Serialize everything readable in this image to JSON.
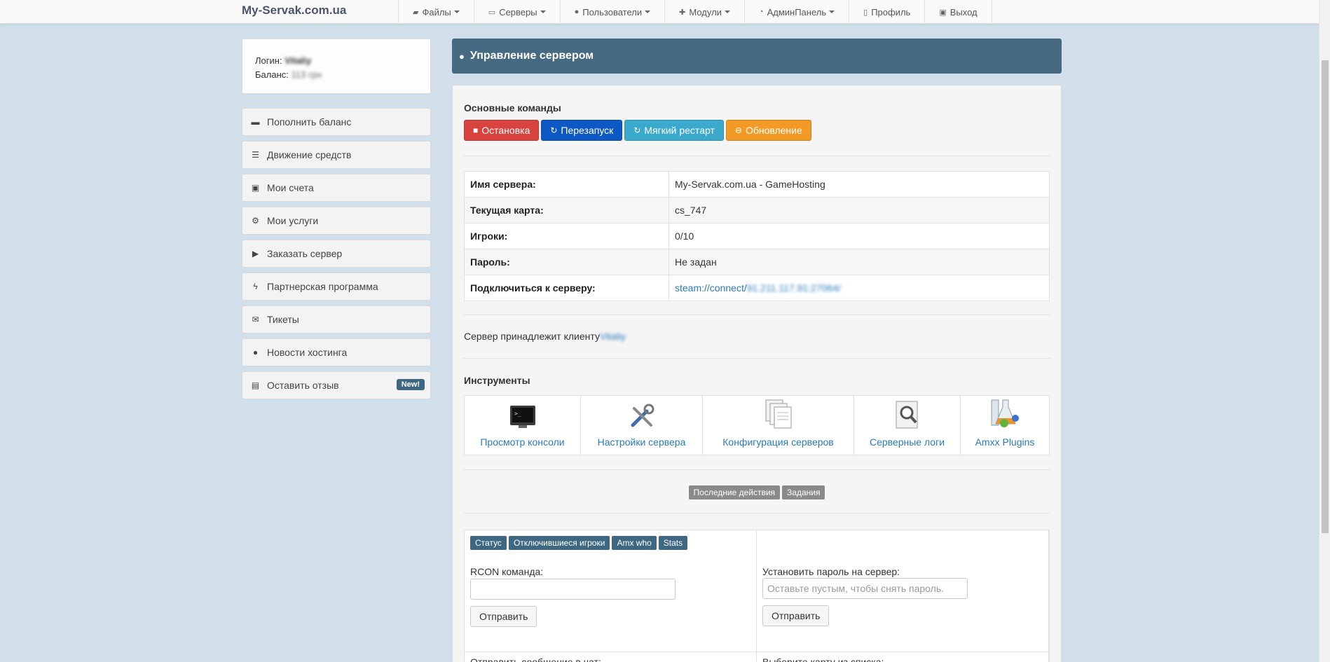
{
  "navbar": {
    "brand": "My-Servak.com.ua",
    "items": [
      {
        "label": "Файлы",
        "icon": "folder-open-icon",
        "glyph": "▰",
        "dropdown": true
      },
      {
        "label": "Серверы",
        "icon": "hdd-icon",
        "glyph": "▭",
        "dropdown": true
      },
      {
        "label": "Пользователи",
        "icon": "user-icon",
        "glyph": "●",
        "dropdown": true
      },
      {
        "label": "Модули",
        "icon": "plus-icon",
        "glyph": "✚",
        "dropdown": true
      },
      {
        "label": "АдминПанель",
        "icon": "rss-icon",
        "glyph": "◔",
        "dropdown": true
      },
      {
        "label": "Профиль",
        "icon": "file-icon",
        "glyph": "▯",
        "dropdown": false
      },
      {
        "label": "Выход",
        "icon": "lock-icon",
        "glyph": "▣",
        "dropdown": false
      }
    ]
  },
  "user": {
    "login_label": "Логин:",
    "login_value": "Vitaliy",
    "balance_label": "Баланс:",
    "balance_value": "113 грн"
  },
  "sidebar": {
    "items": [
      {
        "label": "Пополнить баланс",
        "icon": "credit-card-icon",
        "glyph": "▬"
      },
      {
        "label": "Движение средств",
        "icon": "list-icon",
        "glyph": "☰"
      },
      {
        "label": "Мои счета",
        "icon": "money-icon",
        "glyph": "▣"
      },
      {
        "label": "Мои услуги",
        "icon": "cogs-icon",
        "glyph": "⚙"
      },
      {
        "label": "Заказать сервер",
        "icon": "truck-icon",
        "glyph": "▶"
      },
      {
        "label": "Партнерская программа",
        "icon": "bolt-icon",
        "glyph": "ϟ"
      },
      {
        "label": "Тикеты",
        "icon": "envelope-icon",
        "glyph": "✉"
      },
      {
        "label": "Новости хостинга",
        "icon": "globe-icon",
        "glyph": "●"
      },
      {
        "label": "Оставить отзыв",
        "icon": "comment-icon",
        "glyph": "▤",
        "badge": "New!"
      }
    ]
  },
  "panel": {
    "title": "Управление сервером",
    "commands_title": "Основные команды",
    "commands": [
      {
        "label": "Остановка",
        "icon": "stop-icon",
        "glyph": "■",
        "color": "red"
      },
      {
        "label": "Перезапуск",
        "icon": "refresh-icon",
        "glyph": "↻",
        "color": "blue"
      },
      {
        "label": "Мягкий рестарт",
        "icon": "refresh-icon",
        "glyph": "↻",
        "color": "cyan"
      },
      {
        "label": "Обновление",
        "icon": "minus-circle-icon",
        "glyph": "⊖",
        "color": "orange"
      }
    ],
    "info": [
      {
        "key": "Имя сервера:",
        "value": "My-Servak.com.ua - GameHosting"
      },
      {
        "key": "Текущая карта:",
        "value": "cs_747"
      },
      {
        "key": "Игроки:",
        "value": "0/10"
      },
      {
        "key": "Пароль:",
        "value": "Не задан"
      },
      {
        "key": "Подключиться к серверу:",
        "value": "steam://connect/",
        "value_blurred": "91.211.117.91:27064/"
      }
    ],
    "owner_text": "Сервер принадлежит клиенту",
    "owner_name": "Vitaliy",
    "tools_title": "Инструменты",
    "tools": [
      {
        "label": "Просмотр консоли",
        "icon": "console-icon"
      },
      {
        "label": "Настройки сервера",
        "icon": "tools-icon"
      },
      {
        "label": "Конфигурация серверов",
        "icon": "documents-icon"
      },
      {
        "label": "Серверные логи",
        "icon": "logs-search-icon"
      },
      {
        "label": "Amxx Plugins",
        "icon": "flasks-icon"
      }
    ],
    "tabs": [
      "Последние действия",
      "Задания"
    ],
    "rcon": {
      "quick": [
        "Статус",
        "Отключившиеся игроки",
        "Amx who",
        "Stats"
      ],
      "label": "RCON команда:",
      "value": "",
      "send": "Отправить"
    },
    "password": {
      "label": "Установить пароль на сервер:",
      "placeholder": "Оставьте пустым, чтобы снять пароль.",
      "send": "Отправить"
    },
    "chat_label": "Отправить сообщение в чат:",
    "map_label": "Выберите карту из списка:"
  }
}
